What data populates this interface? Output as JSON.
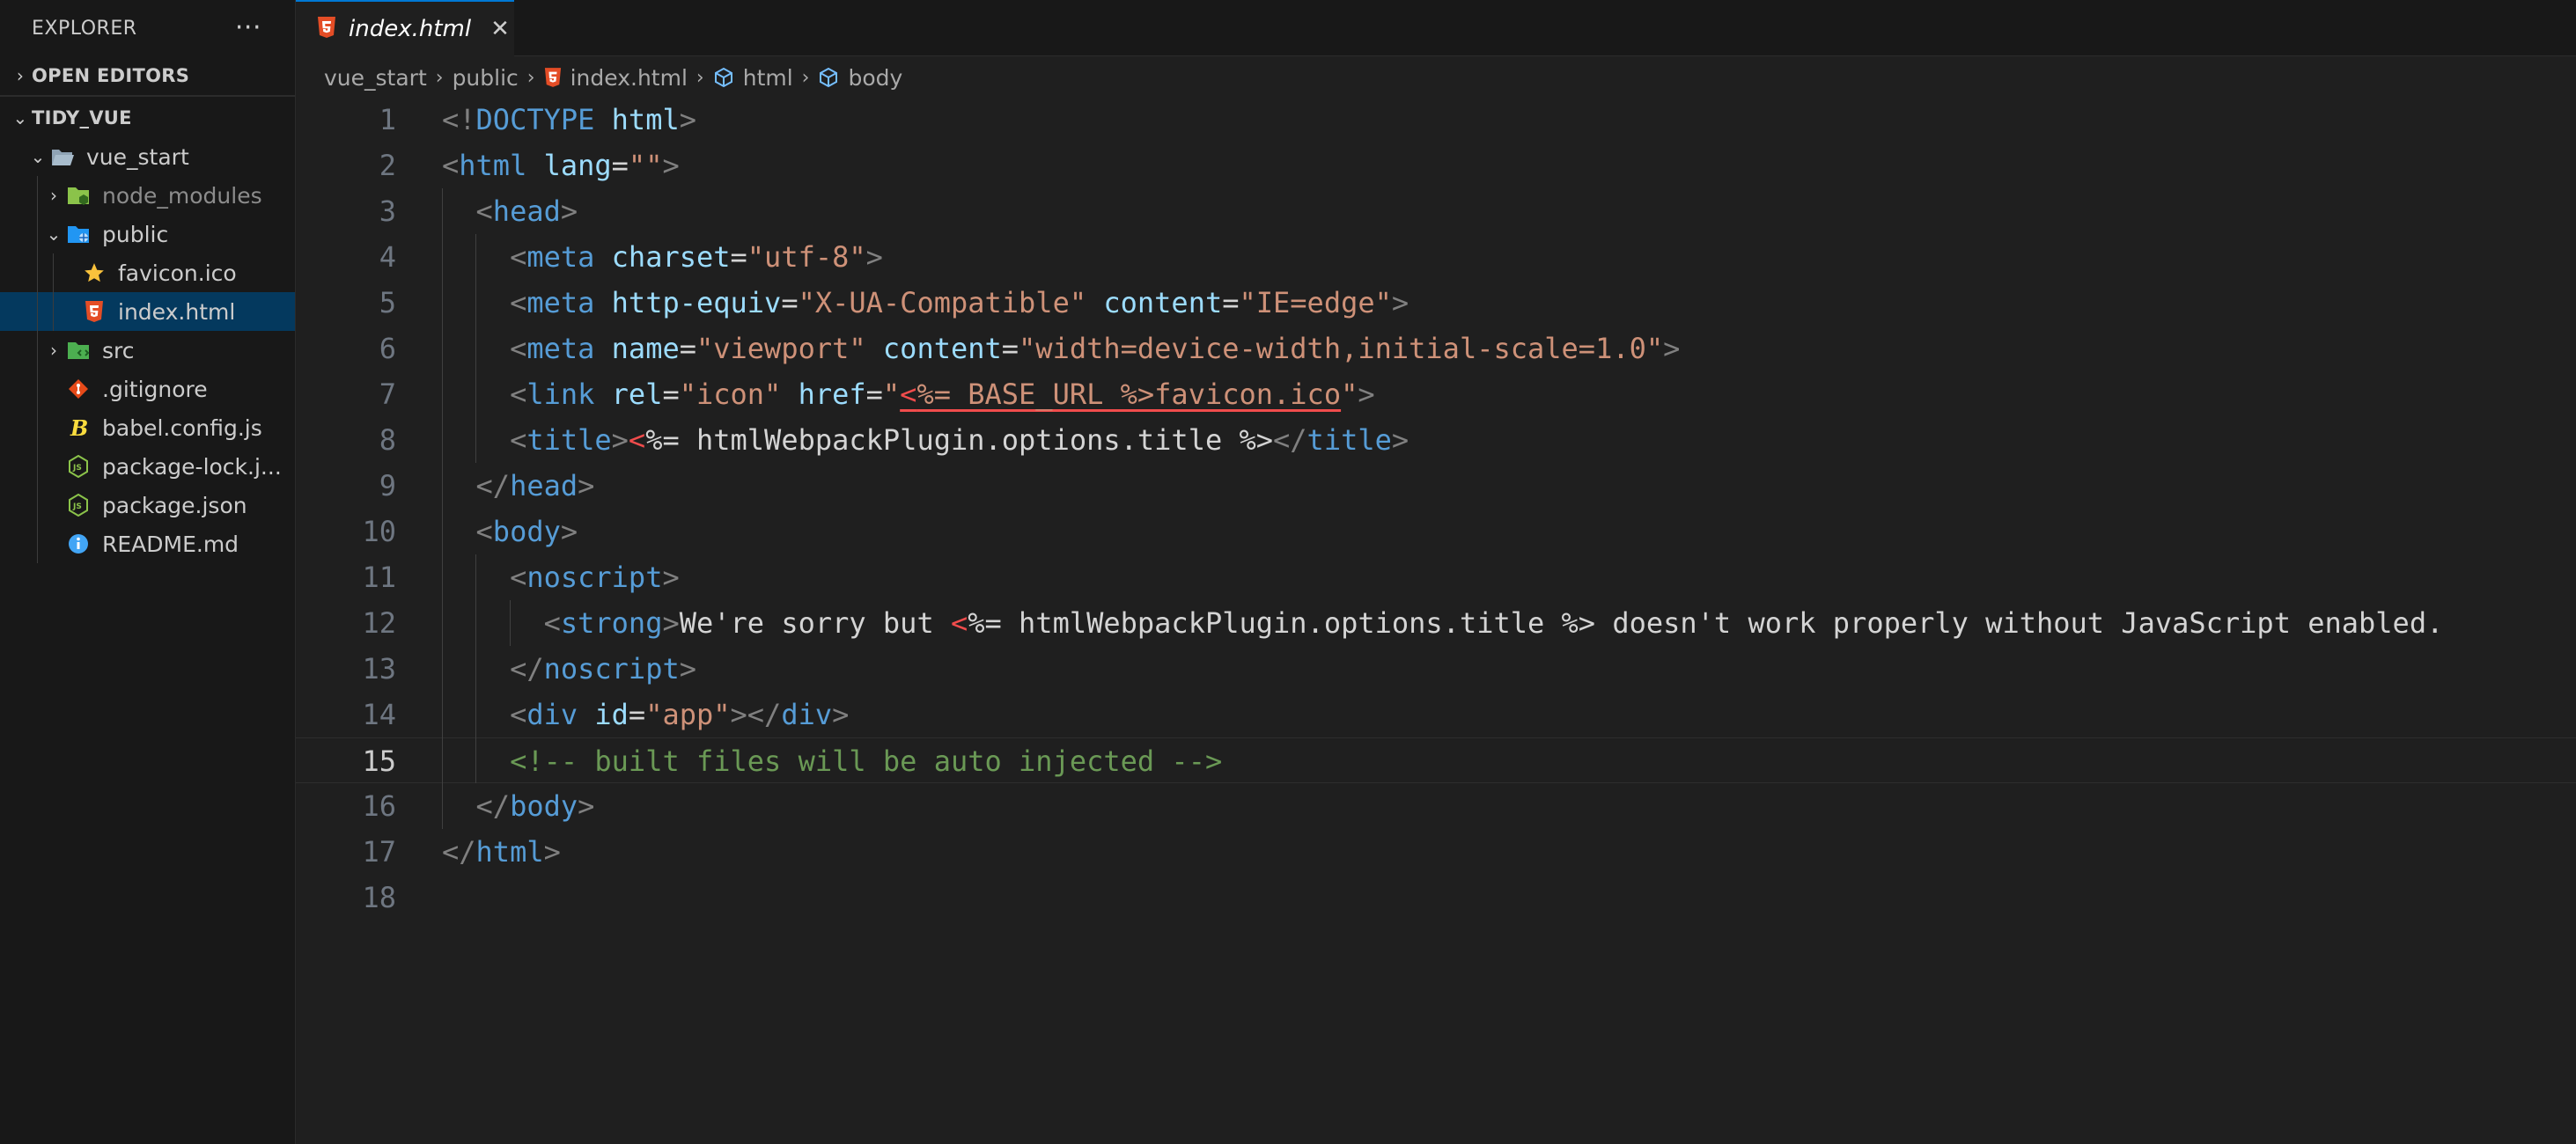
{
  "explorer": {
    "title": "EXPLORER",
    "more": "···",
    "open_editors": "OPEN EDITORS",
    "project": "TIDY_VUE",
    "tree": [
      {
        "label": "vue_start",
        "depth": 1,
        "twist": "⌄",
        "icon": "folder-open-icon"
      },
      {
        "label": "node_modules",
        "depth": 2,
        "twist": "›",
        "icon": "node-folder-icon",
        "dim": true
      },
      {
        "label": "public",
        "depth": 2,
        "twist": "⌄",
        "icon": "public-folder-icon"
      },
      {
        "label": "favicon.ico",
        "depth": 3,
        "twist": "",
        "icon": "star-icon"
      },
      {
        "label": "index.html",
        "depth": 3,
        "twist": "",
        "icon": "html5-icon",
        "selected": true
      },
      {
        "label": "src",
        "depth": 2,
        "twist": "›",
        "icon": "src-folder-icon"
      },
      {
        "label": ".gitignore",
        "depth": 2,
        "twist": "",
        "icon": "git-icon"
      },
      {
        "label": "babel.config.js",
        "depth": 2,
        "twist": "",
        "icon": "babel-icon"
      },
      {
        "label": "package-lock.j...",
        "depth": 2,
        "twist": "",
        "icon": "nodejs-icon"
      },
      {
        "label": "package.json",
        "depth": 2,
        "twist": "",
        "icon": "nodejs-icon"
      },
      {
        "label": "README.md",
        "depth": 2,
        "twist": "",
        "icon": "info-icon"
      }
    ]
  },
  "tab": {
    "name": "index.html",
    "close": "✕"
  },
  "breadcrumb": [
    "vue_start",
    "public",
    "index.html",
    "html",
    "body"
  ],
  "editor": {
    "current_line": 15,
    "lines": [
      [
        [
          "punc",
          "<!"
        ],
        [
          "doctype",
          "DOCTYPE"
        ],
        [
          "text",
          " "
        ],
        [
          "attr",
          "html"
        ],
        [
          "punc",
          ">"
        ]
      ],
      [
        [
          "punc",
          "<"
        ],
        [
          "tag",
          "html"
        ],
        [
          "text",
          " "
        ],
        [
          "attr",
          "lang"
        ],
        [
          "text",
          "="
        ],
        [
          "str",
          "\"\""
        ],
        [
          "punc",
          ">"
        ]
      ],
      [
        [
          "text",
          "  "
        ],
        [
          "punc",
          "<"
        ],
        [
          "tag",
          "head"
        ],
        [
          "punc",
          ">"
        ]
      ],
      [
        [
          "text",
          "    "
        ],
        [
          "punc",
          "<"
        ],
        [
          "tag",
          "meta"
        ],
        [
          "text",
          " "
        ],
        [
          "attr",
          "charset"
        ],
        [
          "text",
          "="
        ],
        [
          "str",
          "\"utf-8\""
        ],
        [
          "punc",
          ">"
        ]
      ],
      [
        [
          "text",
          "    "
        ],
        [
          "punc",
          "<"
        ],
        [
          "tag",
          "meta"
        ],
        [
          "text",
          " "
        ],
        [
          "attr",
          "http-equiv"
        ],
        [
          "text",
          "="
        ],
        [
          "str",
          "\"X-UA-Compatible\""
        ],
        [
          "text",
          " "
        ],
        [
          "attr",
          "content"
        ],
        [
          "text",
          "="
        ],
        [
          "str",
          "\"IE=edge\""
        ],
        [
          "punc",
          ">"
        ]
      ],
      [
        [
          "text",
          "    "
        ],
        [
          "punc",
          "<"
        ],
        [
          "tag",
          "meta"
        ],
        [
          "text",
          " "
        ],
        [
          "attr",
          "name"
        ],
        [
          "text",
          "="
        ],
        [
          "str",
          "\"viewport\""
        ],
        [
          "text",
          " "
        ],
        [
          "attr",
          "content"
        ],
        [
          "text",
          "="
        ],
        [
          "str",
          "\"width=device-width,initial-scale=1.0\""
        ],
        [
          "punc",
          ">"
        ]
      ],
      [
        [
          "text",
          "    "
        ],
        [
          "punc",
          "<"
        ],
        [
          "tag",
          "link"
        ],
        [
          "text",
          " "
        ],
        [
          "attr",
          "rel"
        ],
        [
          "text",
          "="
        ],
        [
          "str",
          "\"icon\""
        ],
        [
          "text",
          " "
        ],
        [
          "attr",
          "href"
        ],
        [
          "text",
          "="
        ],
        [
          "str",
          "\""
        ],
        [
          "ejsu",
          "<"
        ],
        [
          "stru",
          "%= BASE_URL %>favicon.ico"
        ],
        [
          "str",
          "\""
        ],
        [
          "punc",
          ">"
        ]
      ],
      [
        [
          "text",
          "    "
        ],
        [
          "punc",
          "<"
        ],
        [
          "tag",
          "title"
        ],
        [
          "punc",
          ">"
        ],
        [
          "ejs",
          "<"
        ],
        [
          "text",
          "%= htmlWebpackPlugin.options.title %>"
        ],
        [
          "punc",
          "</"
        ],
        [
          "tag",
          "title"
        ],
        [
          "punc",
          ">"
        ]
      ],
      [
        [
          "text",
          "  "
        ],
        [
          "punc",
          "</"
        ],
        [
          "tag",
          "head"
        ],
        [
          "punc",
          ">"
        ]
      ],
      [
        [
          "text",
          "  "
        ],
        [
          "punc",
          "<"
        ],
        [
          "tag",
          "body"
        ],
        [
          "punc",
          ">"
        ]
      ],
      [
        [
          "text",
          "    "
        ],
        [
          "punc",
          "<"
        ],
        [
          "tag",
          "noscript"
        ],
        [
          "punc",
          ">"
        ]
      ],
      [
        [
          "text",
          "      "
        ],
        [
          "punc",
          "<"
        ],
        [
          "tag",
          "strong"
        ],
        [
          "punc",
          ">"
        ],
        [
          "text",
          "We're sorry but "
        ],
        [
          "ejs",
          "<"
        ],
        [
          "text",
          "%= htmlWebpackPlugin.options.title %> doesn't work properly without JavaScript enabled."
        ]
      ],
      [
        [
          "text",
          "    "
        ],
        [
          "punc",
          "</"
        ],
        [
          "tag",
          "noscript"
        ],
        [
          "punc",
          ">"
        ]
      ],
      [
        [
          "text",
          "    "
        ],
        [
          "punc",
          "<"
        ],
        [
          "tag",
          "div"
        ],
        [
          "text",
          " "
        ],
        [
          "attr",
          "id"
        ],
        [
          "text",
          "="
        ],
        [
          "str",
          "\"app\""
        ],
        [
          "punc",
          "></"
        ],
        [
          "tag",
          "div"
        ],
        [
          "punc",
          ">"
        ]
      ],
      [
        [
          "text",
          "    "
        ],
        [
          "comment",
          "<!-- built files will be auto injected -->"
        ]
      ],
      [
        [
          "text",
          "  "
        ],
        [
          "punc",
          "</"
        ],
        [
          "tag",
          "body"
        ],
        [
          "punc",
          ">"
        ]
      ],
      [
        [
          "punc",
          "</"
        ],
        [
          "tag",
          "html"
        ],
        [
          "punc",
          ">"
        ]
      ],
      []
    ]
  }
}
